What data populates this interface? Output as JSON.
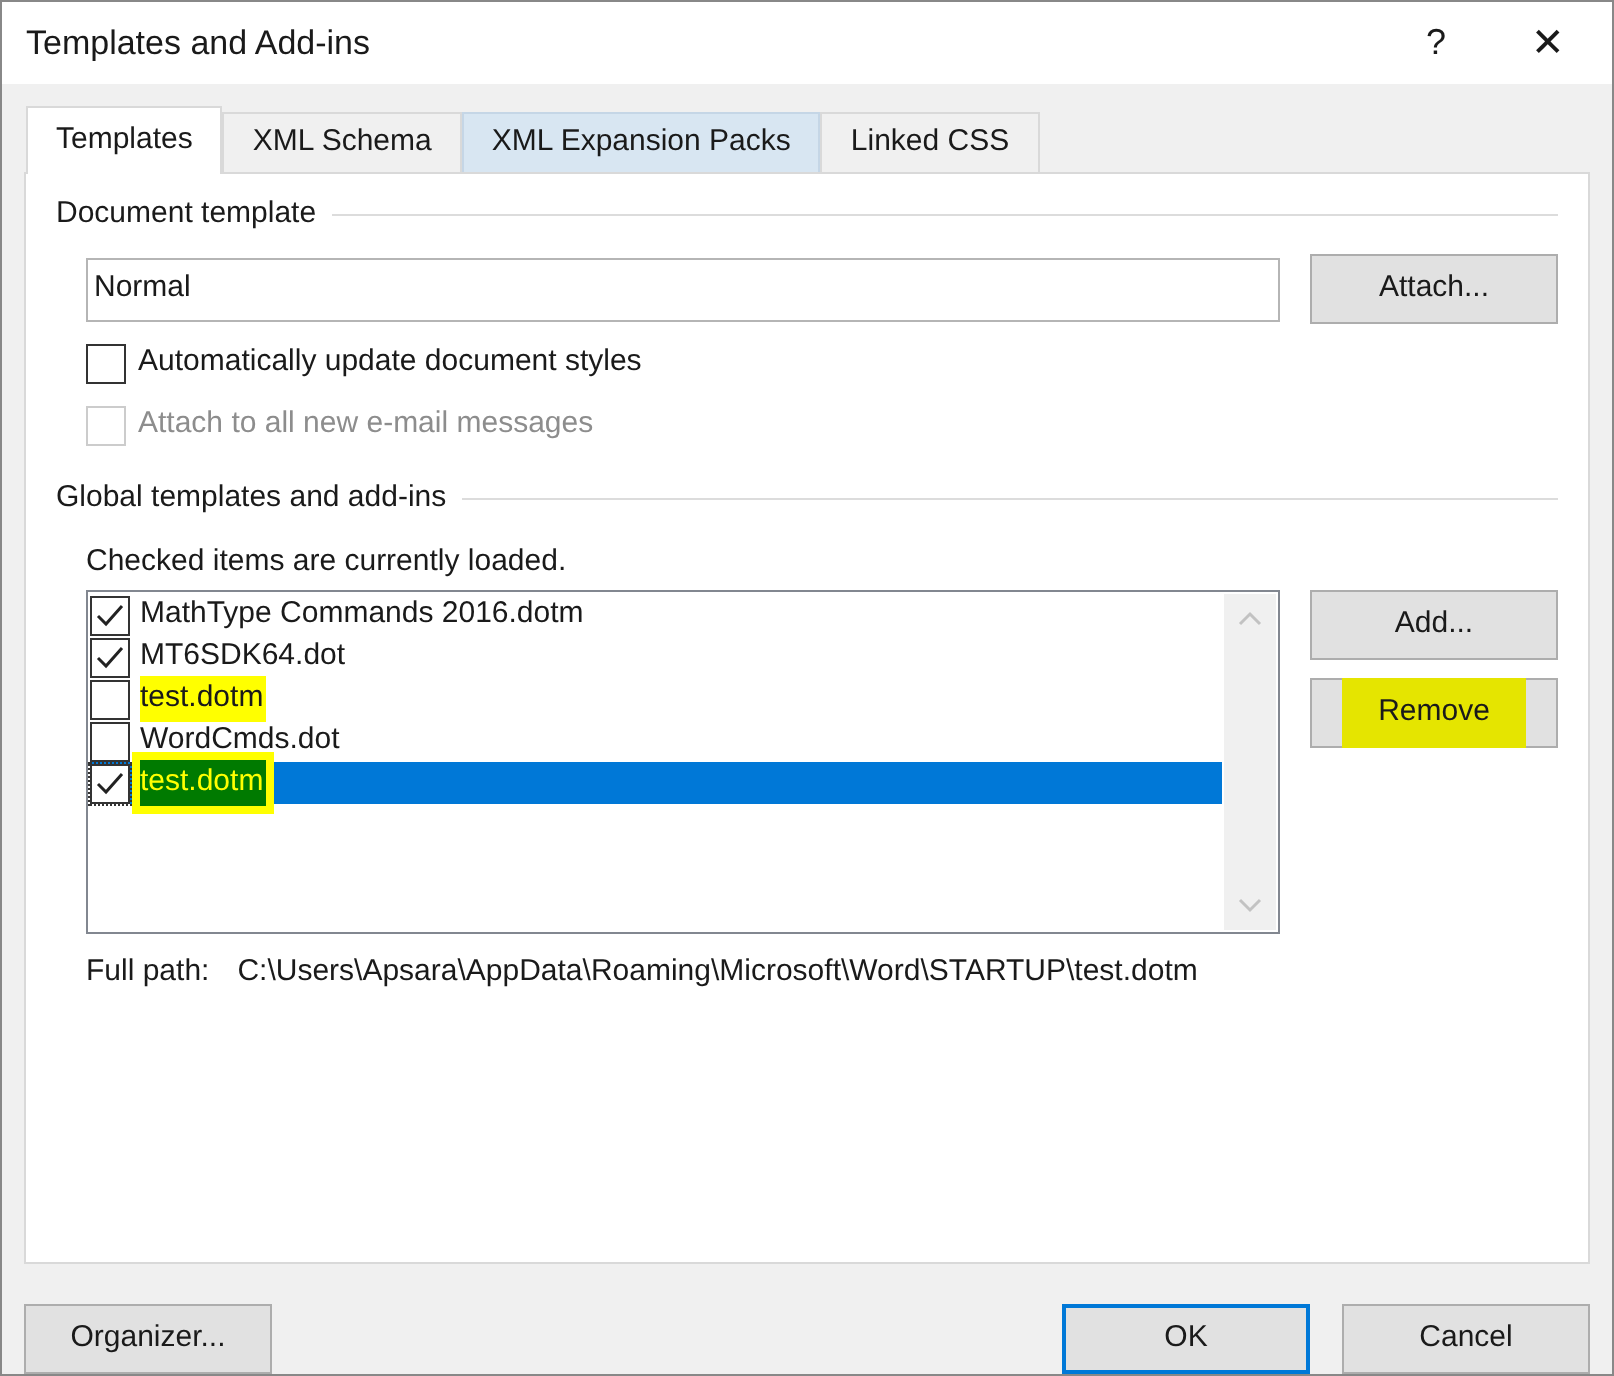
{
  "window": {
    "title": "Templates and Add-ins",
    "help": "?",
    "close": "✕"
  },
  "tabs": [
    {
      "label": "Templates",
      "selected": true,
      "hover": false
    },
    {
      "label": "XML Schema",
      "selected": false,
      "hover": false
    },
    {
      "label": "XML Expansion Packs",
      "selected": false,
      "hover": true
    },
    {
      "label": "Linked CSS",
      "selected": false,
      "hover": false
    }
  ],
  "document_template": {
    "heading": "Document template",
    "value": "Normal",
    "attach_button": "Attach...",
    "options": [
      {
        "label": "Automatically update document styles",
        "checked": false,
        "disabled": false
      },
      {
        "label": "Attach to all new e-mail messages",
        "checked": false,
        "disabled": true
      }
    ]
  },
  "global_templates": {
    "heading": "Global templates and add-ins",
    "note": "Checked items are currently loaded.",
    "items": [
      {
        "label": "MathType Commands 2016.dotm",
        "checked": true,
        "selected": false,
        "highlighted": false
      },
      {
        "label": "MT6SDK64.dot",
        "checked": true,
        "selected": false,
        "highlighted": false
      },
      {
        "label": "test.dotm",
        "checked": false,
        "selected": false,
        "highlighted": true
      },
      {
        "label": "WordCmds.dot",
        "checked": false,
        "selected": false,
        "highlighted": false
      },
      {
        "label": "test.dotm",
        "checked": true,
        "selected": true,
        "highlighted": true
      }
    ],
    "buttons": [
      {
        "label": "Add...",
        "highlighted": false
      },
      {
        "label": "Remove",
        "highlighted": true
      }
    ],
    "full_path_label": "Full path:",
    "full_path": "C:\\Users\\Apsara\\AppData\\Roaming\\Microsoft\\Word\\STARTUP\\test.dotm"
  },
  "footer": {
    "organizer": "Organizer...",
    "ok": "OK",
    "cancel": "Cancel"
  }
}
